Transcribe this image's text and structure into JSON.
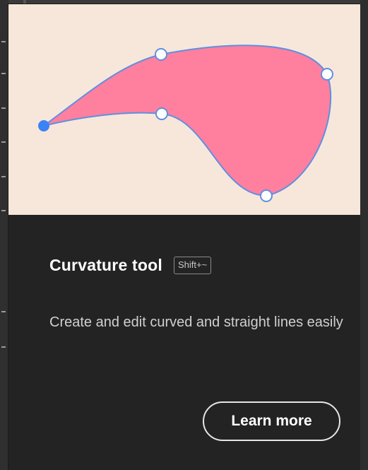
{
  "tooltip": {
    "title": "Curvature tool",
    "shortcut": "Shift+~",
    "description": "Create and edit curved and straight lines easily",
    "learn_more_label": "Learn more"
  },
  "illustration": {
    "background_color": "#f7e7da",
    "shape_fill": "#ff7f9f",
    "path_stroke": "#5f8fe0",
    "anchor_selected_color": "#3b82f6"
  }
}
